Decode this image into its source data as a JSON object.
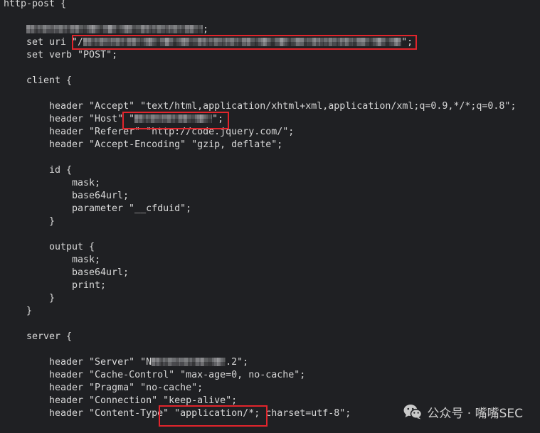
{
  "profile": {
    "open": "http-post {",
    "redacted_statement": {
      "after": ";"
    },
    "set_uri": {
      "before": "set uri \"/",
      "after": "\";"
    },
    "set_verb": "set verb \"POST\";",
    "client": {
      "open": "client {",
      "headers": [
        "header \"Accept\" \"text/html,application/xhtml+xml,application/xml;q=0.9,*/*;q=0.8\";",
        {
          "before": "header \"Host\" \"",
          "after": "\";"
        },
        "header \"Referer\" \"http://code.jquery.com/\";",
        "header \"Accept-Encoding\" \"gzip, deflate\";"
      ],
      "id": {
        "open": "id {",
        "items": [
          "mask;",
          "base64url;",
          "parameter \"__cfduid\";"
        ],
        "close": "}"
      },
      "output": {
        "open": "output {",
        "items": [
          "mask;",
          "base64url;",
          "print;"
        ],
        "close": "}"
      },
      "close": "}"
    },
    "server": {
      "open": "server {",
      "headers": [
        {
          "before": "header \"Server\" \"N",
          "after": ".2\";"
        },
        "header \"Cache-Control\" \"max-age=0, no-cache\";",
        "header \"Pragma\" \"no-cache\";",
        "header \"Connection\" \"keep-alive\";",
        "header \"Content-Type\" \"application/*; charset=utf-8\";"
      ]
    }
  },
  "watermark": {
    "icon": "wechat-icon",
    "label": "公众号 · 嘴嘴SEC"
  },
  "colors": {
    "background": "#1f2023",
    "text": "#d8d8d8",
    "highlight_box": "#e1252c",
    "watermark": "#cfcfcf"
  }
}
